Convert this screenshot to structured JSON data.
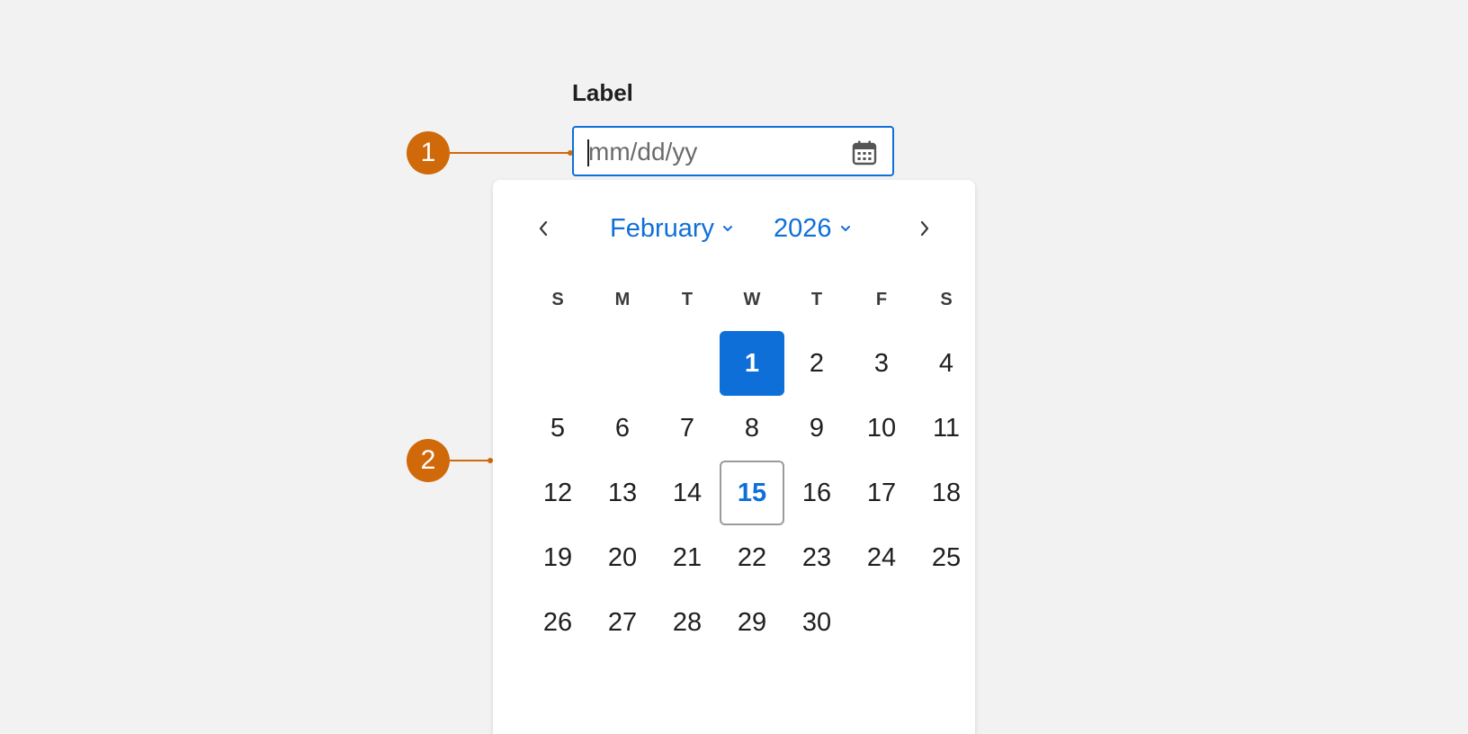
{
  "field": {
    "label": "Label",
    "placeholder": "mm/dd/yy",
    "icon": "calendar-icon"
  },
  "annotations": [
    {
      "number": "1"
    },
    {
      "number": "2"
    }
  ],
  "calendar": {
    "month": "February",
    "year": "2026",
    "prev_icon": "chevron-left-icon",
    "next_icon": "chevron-right-icon",
    "weekdays": [
      "S",
      "M",
      "T",
      "W",
      "T",
      "F",
      "S"
    ],
    "first_weekday_index": 3,
    "days": [
      "1",
      "2",
      "3",
      "4",
      "5",
      "6",
      "7",
      "8",
      "9",
      "10",
      "11",
      "12",
      "13",
      "14",
      "15",
      "16",
      "17",
      "18",
      "19",
      "20",
      "21",
      "22",
      "23",
      "24",
      "25",
      "26",
      "27",
      "28",
      "29",
      "30"
    ],
    "selected_day": "1",
    "today_day": "15"
  },
  "colors": {
    "accent": "#0f6fd9",
    "annotation": "#d0690a",
    "background": "#f2f2f2"
  }
}
